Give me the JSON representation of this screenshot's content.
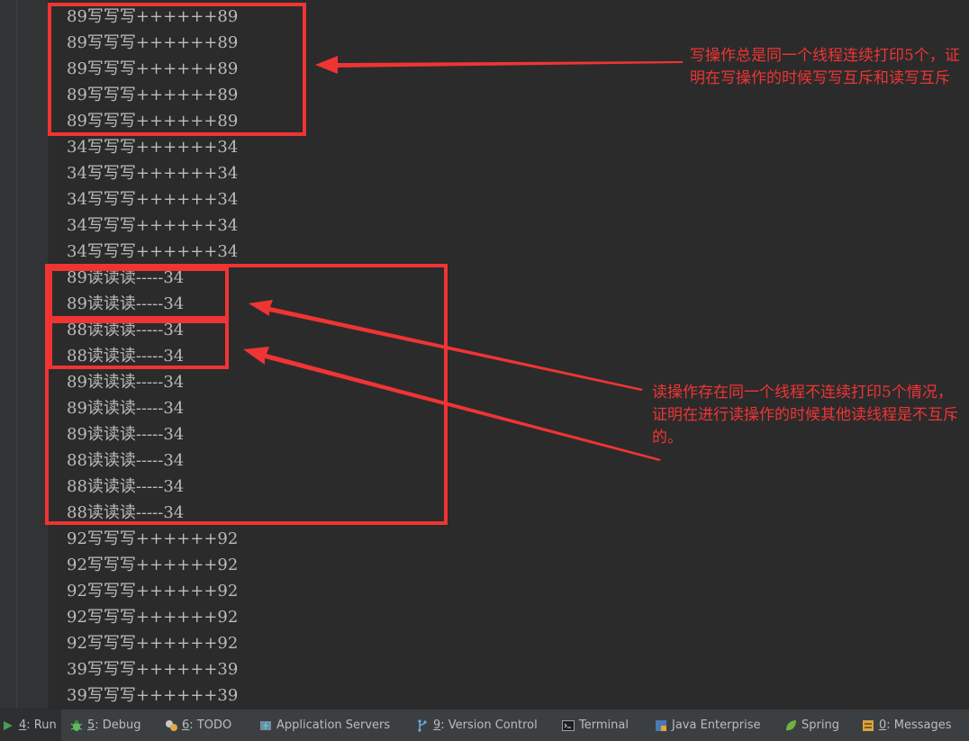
{
  "console": {
    "lines": [
      "89写写写++++++89",
      "89写写写++++++89",
      "89写写写++++++89",
      "89写写写++++++89",
      "89写写写++++++89",
      "34写写写++++++34",
      "34写写写++++++34",
      "34写写写++++++34",
      "34写写写++++++34",
      "34写写写++++++34",
      "89读读读-----34",
      "89读读读-----34",
      "88读读读-----34",
      "88读读读-----34",
      "89读读读-----34",
      "89读读读-----34",
      "89读读读-----34",
      "88读读读-----34",
      "88读读读-----34",
      "88读读读-----34",
      "92写写写++++++92",
      "92写写写++++++92",
      "92写写写++++++92",
      "92写写写++++++92",
      "92写写写++++++92",
      "39写写写++++++39",
      "39写写写++++++39"
    ]
  },
  "annotations": {
    "write_note": "写操作总是同一个线程连续打印5个，证明在写操作的时候写写互斥和读写互斥",
    "read_note": "读操作存在同一个线程不连续打印5个情况，证明在进行读操作的时候其他读线程是不互斥的。",
    "color": "#f03434"
  },
  "toolbar": {
    "items": [
      {
        "num": "4",
        "label": ": Run",
        "icon": "run-icon",
        "active": true
      },
      {
        "num": "5",
        "label": ": Debug",
        "icon": "bug-icon"
      },
      {
        "num": "6",
        "label": ": TODO",
        "icon": "todo-icon"
      },
      {
        "num": "",
        "label": "Application Servers",
        "icon": "globe-icon"
      },
      {
        "num": "9",
        "label": ": Version Control",
        "icon": "branch-icon"
      },
      {
        "num": "",
        "label": "Terminal",
        "icon": "terminal-icon"
      },
      {
        "num": "",
        "label": "Java Enterprise",
        "icon": "java-enterprise-icon"
      },
      {
        "num": "",
        "label": "Spring",
        "icon": "leaf-icon"
      },
      {
        "num": "0",
        "label": ": Messages",
        "icon": "messages-icon"
      }
    ]
  }
}
